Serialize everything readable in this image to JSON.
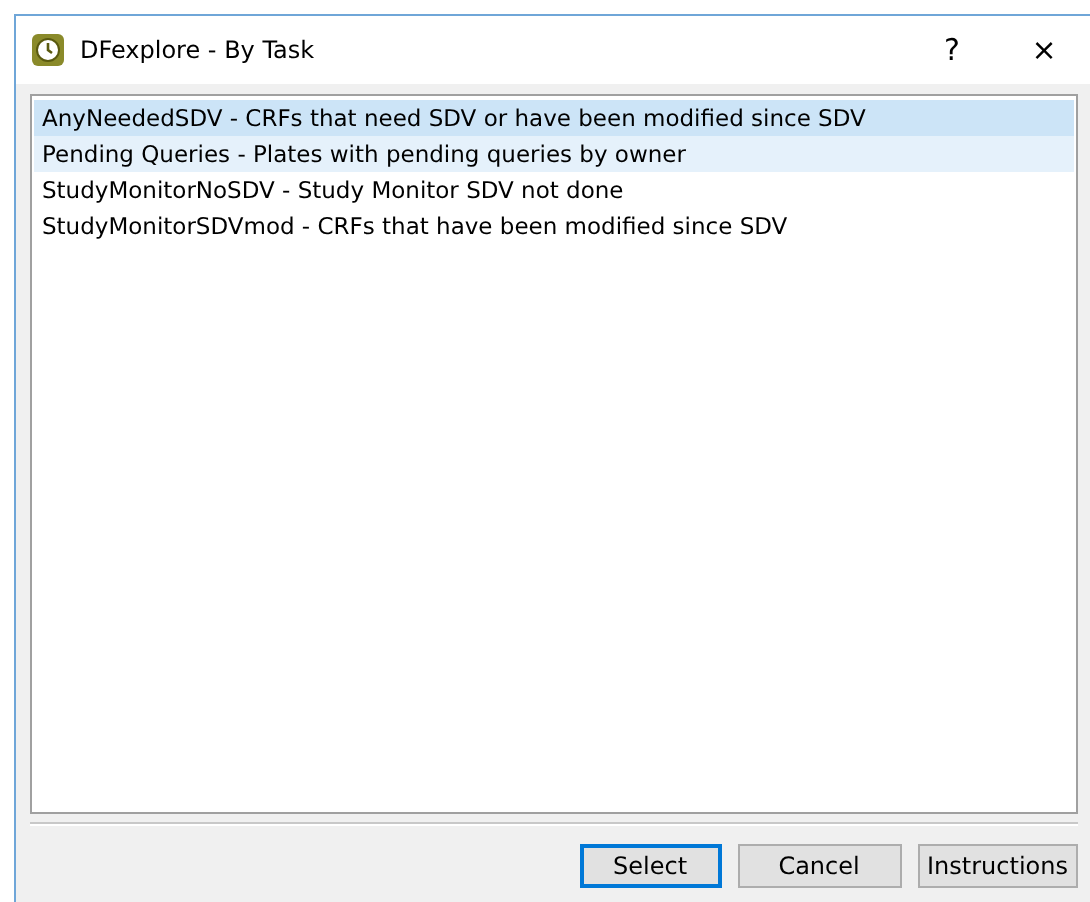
{
  "window": {
    "title": "DFexplore - By Task",
    "help": "?",
    "close": "×"
  },
  "tasks": [
    {
      "label": "AnyNeededSDV - CRFs that need SDV or have been modified since SDV",
      "selected": true,
      "hovered": false
    },
    {
      "label": "Pending Queries - Plates with pending queries by owner",
      "selected": false,
      "hovered": true
    },
    {
      "label": "StudyMonitorNoSDV - Study Monitor SDV not done",
      "selected": false,
      "hovered": false
    },
    {
      "label": "StudyMonitorSDVmod - CRFs that have been modified since SDV",
      "selected": false,
      "hovered": false
    }
  ],
  "buttons": [
    {
      "label": "Select",
      "default": true
    },
    {
      "label": "Cancel",
      "default": false
    },
    {
      "label": "Instructions",
      "default": false
    }
  ]
}
